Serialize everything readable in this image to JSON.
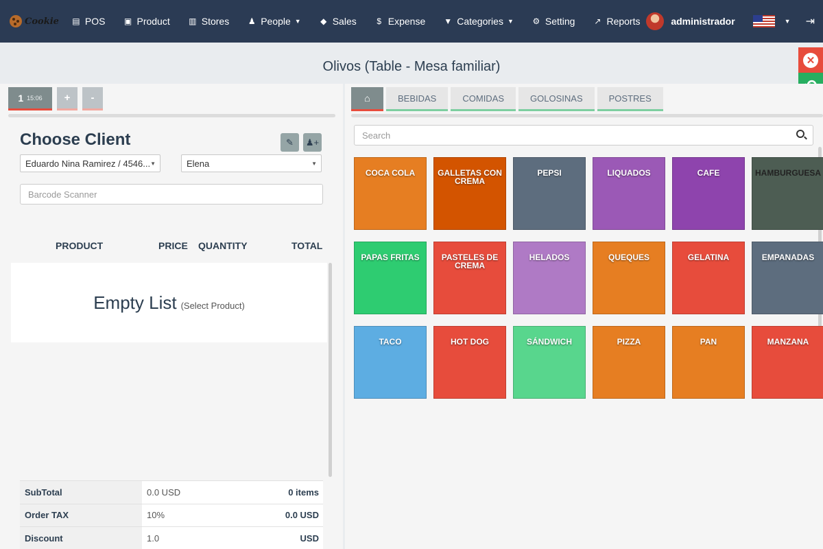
{
  "nav": {
    "logo": "Cookie",
    "items": [
      {
        "label": "POS",
        "icon": "▤",
        "caret": false
      },
      {
        "label": "Product",
        "icon": "▣",
        "caret": false
      },
      {
        "label": "Stores",
        "icon": "▥",
        "caret": false
      },
      {
        "label": "People",
        "icon": "♟",
        "caret": true
      },
      {
        "label": "Sales",
        "icon": "◆",
        "caret": false
      },
      {
        "label": "Expense",
        "icon": "$",
        "caret": false
      },
      {
        "label": "Categories",
        "icon": "▼",
        "caret": true
      },
      {
        "label": "Setting",
        "icon": "⚙",
        "caret": false
      },
      {
        "label": "Reports",
        "icon": "↗",
        "caret": false
      }
    ],
    "username": "administrador"
  },
  "page_title": "Olivos (Table - Mesa familiar)",
  "order_tabs": {
    "active_number": "1",
    "active_time": "15:06",
    "add_label": "+",
    "remove_label": "-"
  },
  "client": {
    "heading": "Choose Client",
    "customer_value": "Eduardo Nina Ramirez / 4546...",
    "waiter_value": "Elena",
    "barcode_placeholder": "Barcode Scanner"
  },
  "table": {
    "headers": [
      "PRODUCT",
      "PRICE",
      "QUANTITY",
      "TOTAL"
    ],
    "empty_main": "Empty List",
    "empty_sub": "(Select Product)"
  },
  "totals": [
    {
      "label": "SubTotal",
      "mid": "0.0 USD",
      "right": "0 items"
    },
    {
      "label": "Order TAX",
      "mid": "10%",
      "right": "0.0 USD"
    },
    {
      "label": "Discount",
      "mid": "1.0",
      "right": "USD"
    }
  ],
  "categories": [
    "BEBIDAS",
    "COMIDAS",
    "GOLOSINAS",
    "POSTRES"
  ],
  "search_placeholder": "Search",
  "products": [
    {
      "name": "COCA COLA",
      "color": "#e67e22"
    },
    {
      "name": "GALLETAS CON CREMA",
      "color": "#d35400"
    },
    {
      "name": "PEPSI",
      "color": "#5d6d7e"
    },
    {
      "name": "LIQUADOS",
      "color": "#9b59b6"
    },
    {
      "name": "CAFE",
      "color": "#8e44ad"
    },
    {
      "name": "HAMBURGUESA",
      "color": "#4d5d53"
    },
    {
      "name": "PAPAS FRITAS",
      "color": "#2ecc71"
    },
    {
      "name": "PASTELES DE CREMA",
      "color": "#e74c3c"
    },
    {
      "name": "HELADOS",
      "color": "#af7ac5"
    },
    {
      "name": "QUEQUES",
      "color": "#e67e22"
    },
    {
      "name": "GELATINA",
      "color": "#e74c3c"
    },
    {
      "name": "EMPANADAS",
      "color": "#5d6d7e"
    },
    {
      "name": "TACO",
      "color": "#5dade2"
    },
    {
      "name": "HOT DOG",
      "color": "#e74c3c"
    },
    {
      "name": "SÁNDWICH",
      "color": "#58d68d"
    },
    {
      "name": "PIZZA",
      "color": "#e67e22"
    },
    {
      "name": "PAN",
      "color": "#e67e22"
    },
    {
      "name": "MANZANA",
      "color": "#e74c3c"
    }
  ]
}
